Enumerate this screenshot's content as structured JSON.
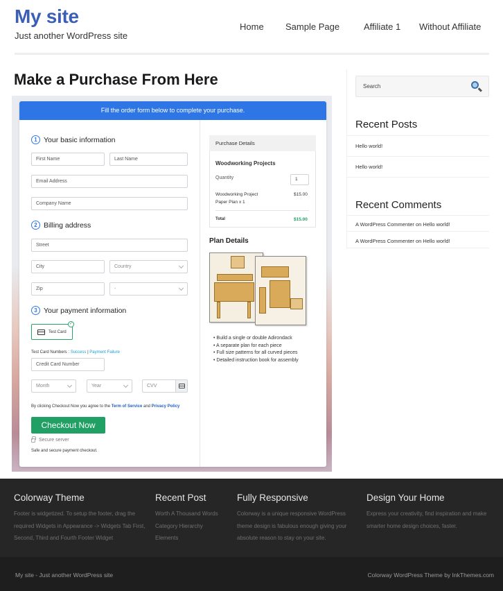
{
  "header": {
    "site_title": "My site",
    "tagline": "Just another WordPress site",
    "nav": [
      "Home",
      "Sample Page",
      "Affiliate 1",
      "Without Affiliate"
    ]
  },
  "page": {
    "title": "Make a Purchase From Here"
  },
  "form": {
    "banner": "Fill the order form below to complete your purchase.",
    "step1": {
      "num": "1",
      "label": "Your basic information"
    },
    "step2": {
      "num": "2",
      "label": "Billing address"
    },
    "step3": {
      "num": "3",
      "label": "Your payment information"
    },
    "fields": {
      "first_name": "First Name",
      "last_name": "Last Name",
      "email": "Email Address",
      "company": "Company Name",
      "street": "Street",
      "city": "City",
      "country": "Country",
      "zip": "Zip",
      "state": "-",
      "card_number": "Credit Card Number",
      "month": "Month",
      "year": "Year",
      "cvv": "CVV"
    },
    "payment_method": "Test Card",
    "test_numbers_label": "Test Card Numbers :",
    "test_success": "Success",
    "test_separator": "|",
    "test_failure": "Payment Failure",
    "agree_prefix": "By clicking Checkout Now you agree to the",
    "terms_link": "Term of Service",
    "agree_and": "and",
    "privacy_link": "Privacy Policy",
    "checkout_button": "Checkout Now",
    "secure_server": "Secure server",
    "safe_text": "Safe and secure payment checkout."
  },
  "purchase": {
    "header": "Purchase Details",
    "product": "Woodworking Projects",
    "quantity_label": "Quantity",
    "quantity_value": "1",
    "line_item_1": "Woodworking Project",
    "line_item_2": "Paper Plan x 1",
    "line_price": "$15.00",
    "total_label": "Total",
    "total_value": "$15.00",
    "total_color": "#21a065"
  },
  "plan": {
    "title": "Plan Details",
    "bullets": [
      "Build a single or double Adirondack",
      "A separate plan for each piece",
      "Full size patterns for all curved pieces",
      "Detailed instruction book for assembly"
    ]
  },
  "sidebar": {
    "search_placeholder": "Search",
    "recent_posts_title": "Recent Posts",
    "recent_posts": [
      "Hello world!",
      "Hello world!"
    ],
    "recent_comments_title": "Recent Comments",
    "recent_comments": [
      "A WordPress Commenter on Hello world!",
      "A WordPress Commenter on Hello world!"
    ]
  },
  "footer": {
    "col1_title": "Colorway Theme",
    "col1_text": "Footer is widgetized. To setup the footer, drag the required Widgets in Appearance -> Widgets Tab First, Second, Third and Fourth Footer Widget",
    "col2_title": "Recent Post",
    "col2_items": [
      "Worth A Thousand Words",
      "Category Hierarchy",
      "Elements"
    ],
    "col3_title": "Fully Responsive",
    "col3_text": "Colorway is a unique responsive WordPress theme design is fabulous enough giving your absolute reason to stay on your site.",
    "col4_title": "Design Your Home",
    "col4_text": "Express your creativity, find inspiration and make smarter home design choices, faster.",
    "bottom_left": "My site - Just another WordPress site",
    "bottom_right": "Colorway WordPress Theme by InkThemes.com"
  },
  "colors": {
    "brand_blue": "#3b5fb5",
    "banner_blue": "#2e76e6",
    "checkout_green": "#21a065",
    "footer_bg": "#262626"
  }
}
